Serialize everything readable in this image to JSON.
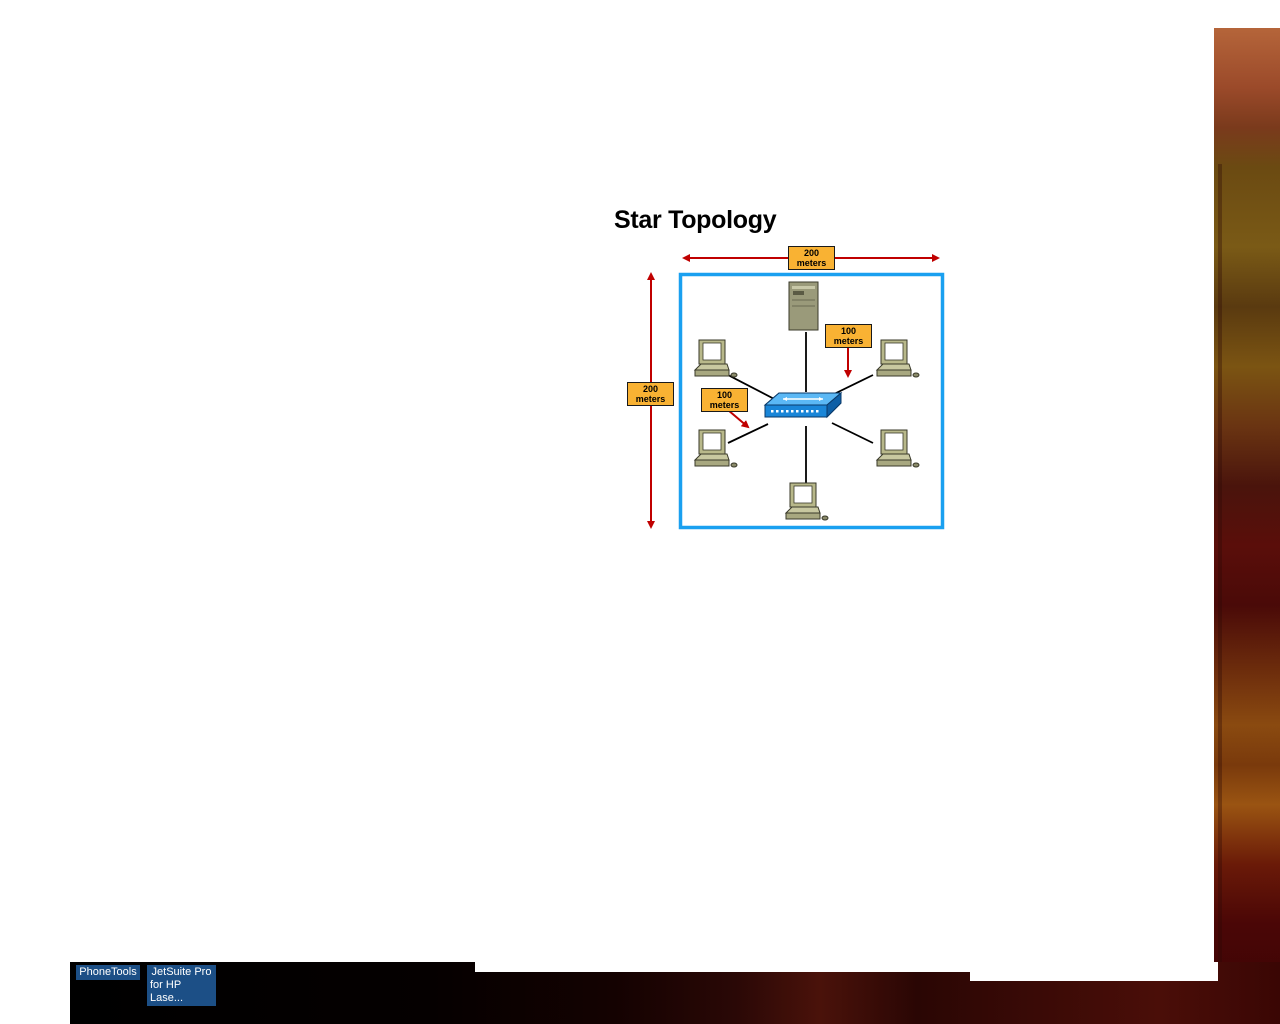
{
  "slide": {
    "title": "Star Topology"
  },
  "diagram": {
    "top_label": {
      "value": "200",
      "unit": "meters"
    },
    "left_label": {
      "value": "200",
      "unit": "meters"
    },
    "upper_right_label": {
      "value": "100",
      "unit": "meters"
    },
    "mid_left_label": {
      "value": "100",
      "unit": "meters"
    },
    "colors": {
      "boundary": "#1aa0f0",
      "arrow": "#c00000",
      "label_fill": "#f9b233",
      "switch": "#1a86d8"
    }
  },
  "desktop": {
    "shortcuts": [
      {
        "label": "PhoneTools"
      },
      {
        "label_line1": "JetSuite Pro",
        "label_line2": "for HP Lase..."
      }
    ]
  }
}
